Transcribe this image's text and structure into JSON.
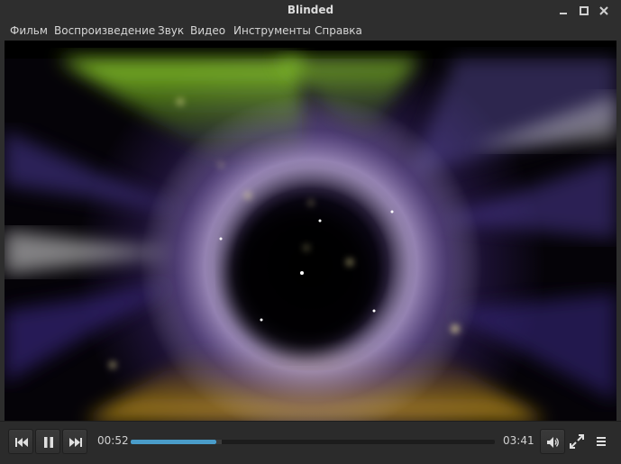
{
  "window": {
    "title": "Blinded",
    "controls": [
      "minimize-icon",
      "maximize-icon",
      "close-icon"
    ]
  },
  "menu": {
    "items": [
      {
        "label": "Фильм"
      },
      {
        "label": "Воспроизведение"
      },
      {
        "label": "Звук"
      },
      {
        "label": "Видео"
      },
      {
        "label": "Инструменты"
      },
      {
        "label": "Справка"
      }
    ]
  },
  "player": {
    "current_time": "00:52",
    "total_time": "03:41",
    "progress_fraction": 0.235,
    "buffered_fraction": 0.25,
    "accent_color": "#4a9cc9",
    "buttons": {
      "previous": "skip-previous-icon",
      "pause": "pause-icon",
      "next": "skip-next-icon",
      "volume": "volume-icon",
      "fullscreen": "fullscreen-icon",
      "menu": "hamburger-menu-icon"
    }
  }
}
